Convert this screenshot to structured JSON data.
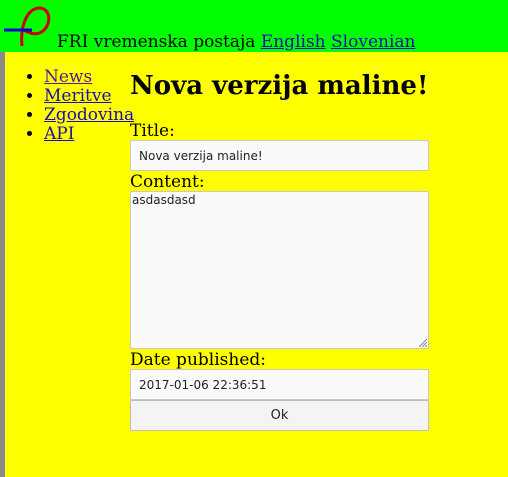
{
  "header": {
    "site_name": "FRI vremenska postaja",
    "lang_english": "English",
    "lang_slovenian": "Slovenian",
    "logo_icon": "fri-logo-icon"
  },
  "nav": {
    "items": [
      {
        "label": "News"
      },
      {
        "label": "Meritve"
      },
      {
        "label": "Zgodovina"
      },
      {
        "label": "API"
      }
    ]
  },
  "form": {
    "heading": "Nova verzija maline!",
    "title_label": "Title:",
    "title_value": "Nova verzija maline!",
    "content_label": "Content:",
    "content_value": "asdasdasd",
    "date_label": "Date published:",
    "date_value": "2017-01-06 22:36:51",
    "ok_label": "Ok"
  },
  "colors": {
    "header_bg": "#00ff00",
    "page_bg": "#ffff00",
    "link": "#1a0dab",
    "visited_link": "#551a8b",
    "logo_red": "#cc0000",
    "logo_blue": "#0000cc"
  }
}
